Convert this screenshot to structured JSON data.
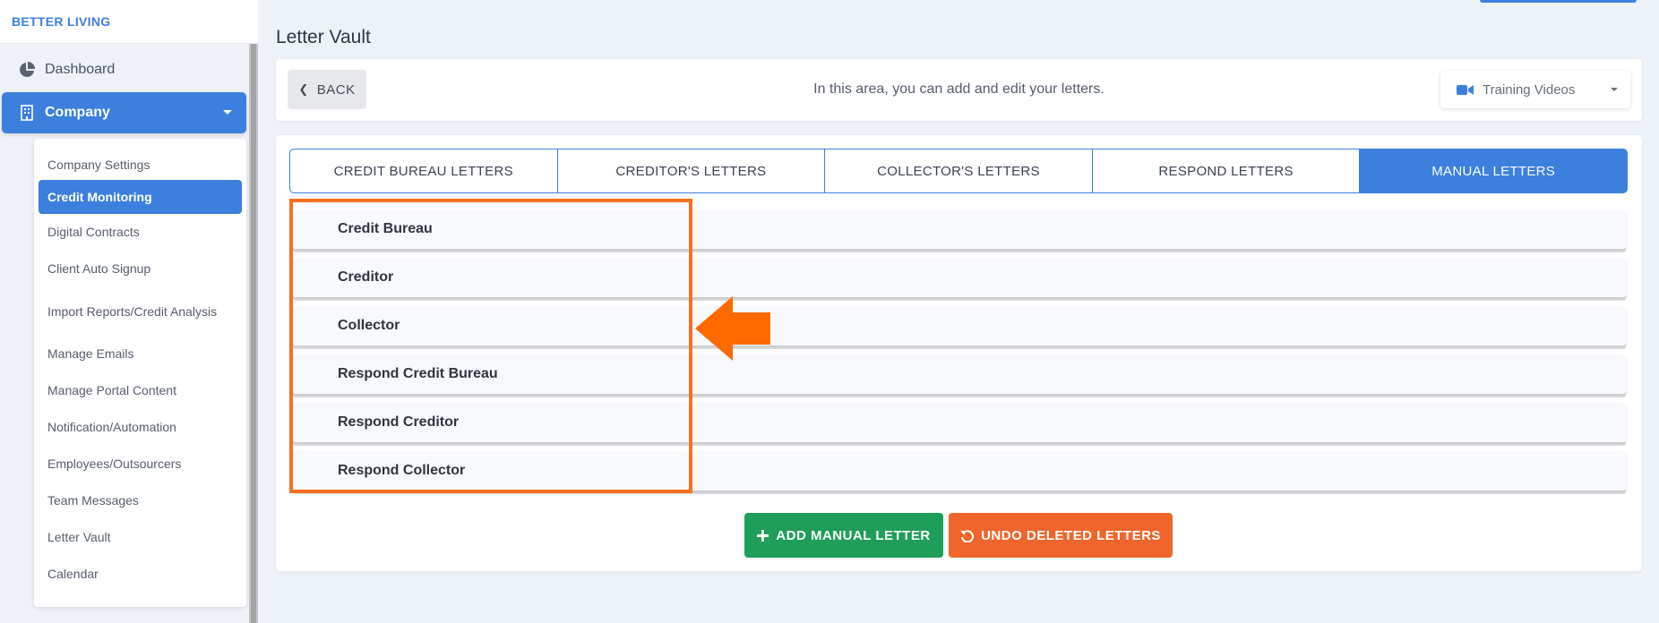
{
  "brand": "BETTER LIVING",
  "nav": {
    "dashboard": "Dashboard",
    "company": "Company"
  },
  "submenu": [
    "Company Settings",
    "Credit Monitoring",
    "Digital Contracts",
    "Client Auto Signup",
    "Import Reports/Credit Analysis",
    "Manage Emails",
    "Manage Portal Content",
    "Notification/Automation",
    "Employees/Outsourcers",
    "Team Messages",
    "Letter Vault",
    "Calendar"
  ],
  "submenu_active": "Credit Monitoring",
  "page": {
    "title": "Letter Vault",
    "back_label": "BACK",
    "info_text": "In this area, you can add and edit your letters.",
    "training_label": "Training Videos"
  },
  "tabs": [
    "CREDIT BUREAU LETTERS",
    "CREDITOR'S LETTERS",
    "COLLECTOR'S LETTERS",
    "RESPOND LETTERS",
    "MANUAL LETTERS"
  ],
  "active_tab": "MANUAL LETTERS",
  "letters": [
    "Credit Bureau",
    "Creditor",
    "Collector",
    "Respond Credit Bureau",
    "Respond Creditor",
    "Respond Collector"
  ],
  "buttons": {
    "add": "ADD MANUAL LETTER",
    "undo": "UNDO DELETED LETTERS"
  },
  "colors": {
    "accent": "#3d7fdc",
    "add_button": "#1f9e5a",
    "undo_button": "#f0652b",
    "highlight": "#f57122"
  }
}
